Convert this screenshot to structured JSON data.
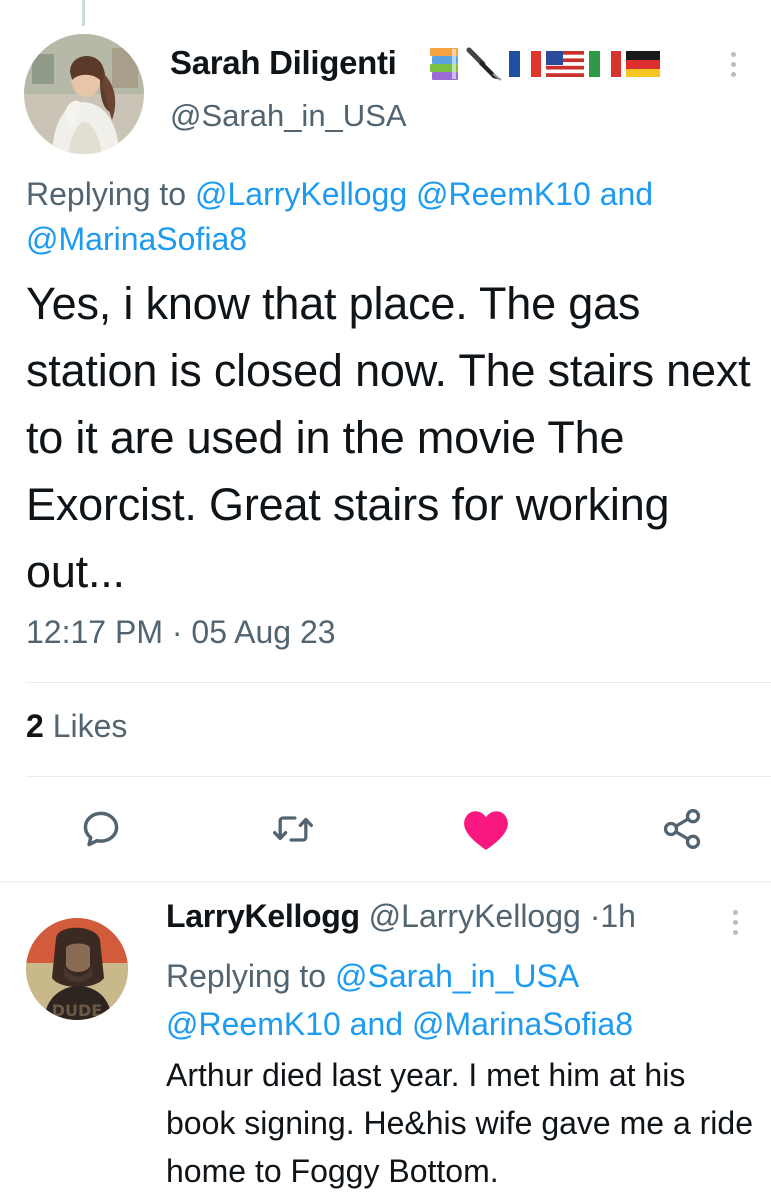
{
  "tweet": {
    "author_name": "Sarah Diligenti",
    "author_handle": "@Sarah_in_USA",
    "badges": [
      "books-emoji",
      "fountain-pen-emoji",
      "flag-france",
      "flag-usa",
      "flag-italy",
      "flag-germany"
    ],
    "replying_prefix": "Replying to",
    "replying_handles": [
      "@LarryKellogg",
      "@ReemK10"
    ],
    "replying_and": "and",
    "replying_last": "@MarinaSofia8",
    "text": "Yes, i know that place. The gas station is closed now. The stairs next to it are  used in the movie The Exorcist. Great stairs for working out...",
    "timestamp": "12:17 PM · 05 Aug 23",
    "likes_count": "2",
    "likes_label": "Likes"
  },
  "actions": [
    {
      "icon": "reply-icon"
    },
    {
      "icon": "retweet-icon"
    },
    {
      "icon": "heart-icon",
      "active": true,
      "color": "#f91880"
    },
    {
      "icon": "share-icon"
    }
  ],
  "reply": {
    "author_name": "LarryKellogg",
    "author_handle": "@LarryKellogg",
    "time_separator": "·",
    "time": "1h",
    "replying_prefix": "Replying to",
    "replying_first": "@Sarah_in_USA",
    "replying_second": "@ReemK10",
    "replying_and": "and",
    "replying_last": "@MarinaSofia8",
    "text": "Arthur died last year. I met him at his book signing. He&his wife gave me a ride home to Foggy Bottom.",
    "avatar_caption": "DUDE"
  },
  "colors": {
    "accent": "#1d9bf0",
    "secondary_text": "#536471",
    "like": "#f91880"
  }
}
